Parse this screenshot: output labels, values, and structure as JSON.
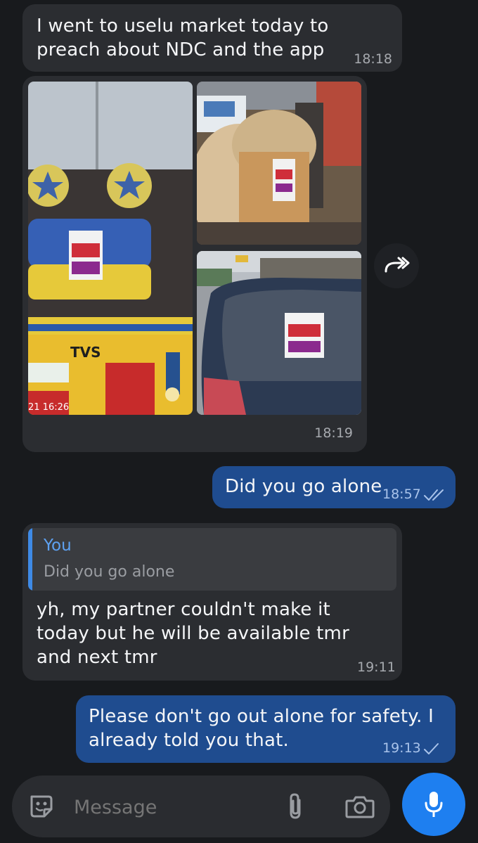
{
  "messages": {
    "m1": {
      "text": "I went to uselu market today to preach about NDC and the app",
      "time": "18:18"
    },
    "m2": {
      "photo_overlay": "21 16:26",
      "photo_text": "TVS",
      "time": "18:19"
    },
    "m3": {
      "text": "Did you go alone",
      "time": "18:57"
    },
    "m4": {
      "reply_author": "You",
      "reply_text": "Did you go alone",
      "text": "yh, my partner couldn't make it today but he will be available tmr and next tmr",
      "time": "19:11"
    },
    "m5": {
      "text": "Please don't go out alone for safety. I already told you that.",
      "time": "19:13"
    }
  },
  "composer": {
    "placeholder": "Message"
  },
  "colors": {
    "background": "#181a1d",
    "incoming_bubble": "#2b2d31",
    "outgoing_bubble": "#1f4c8f",
    "accent": "#1e7ff0",
    "reply_bar": "#3e8ae6"
  },
  "icons": {
    "forward": "forward-arrow-icon",
    "sticker": "sticker-icon",
    "attach": "paperclip-icon",
    "camera": "camera-icon",
    "mic": "microphone-icon"
  }
}
